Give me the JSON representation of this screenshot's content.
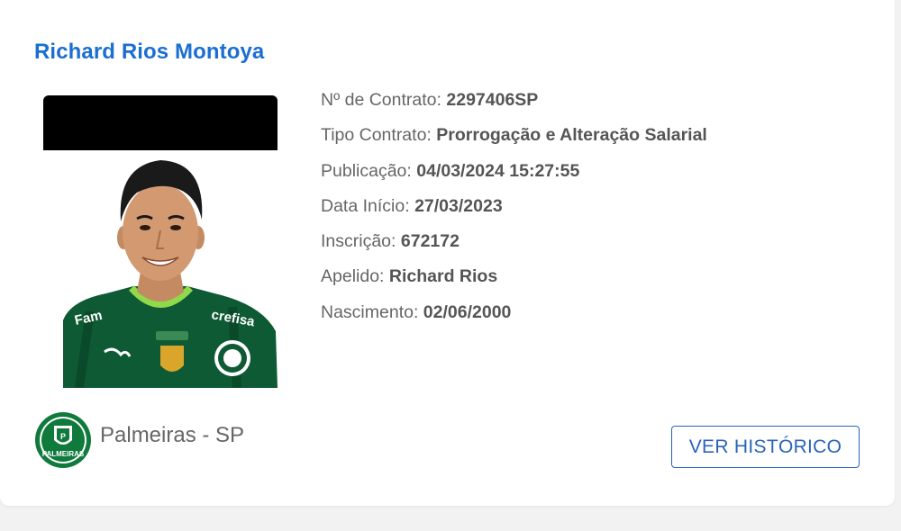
{
  "player": {
    "name": "Richard Rios Montoya"
  },
  "details": [
    {
      "label": "Nº de Contrato:",
      "value": "2297406SP"
    },
    {
      "label": "Tipo Contrato:",
      "value": "Prorrogação e Alteração Salarial"
    },
    {
      "label": "Publicação:",
      "value": "04/03/2024 15:27:55"
    },
    {
      "label": "Data Início:",
      "value": "27/03/2023"
    },
    {
      "label": "Inscrição:",
      "value": "672172"
    },
    {
      "label": "Apelido:",
      "value": "Richard Rios"
    },
    {
      "label": "Nascimento:",
      "value": "02/06/2000"
    }
  ],
  "club": {
    "name": "Palmeiras - SP",
    "crest_text": "PALMEIRAS"
  },
  "jersey": {
    "sponsor_left": "Fam",
    "sponsor_right": "crefisa"
  },
  "actions": {
    "history_label": "VER HISTÓRICO"
  },
  "colors": {
    "title": "#1b6fd1",
    "button": "#2a63b8",
    "jersey": "#0e5a34",
    "club_green": "#0f7a3c"
  }
}
